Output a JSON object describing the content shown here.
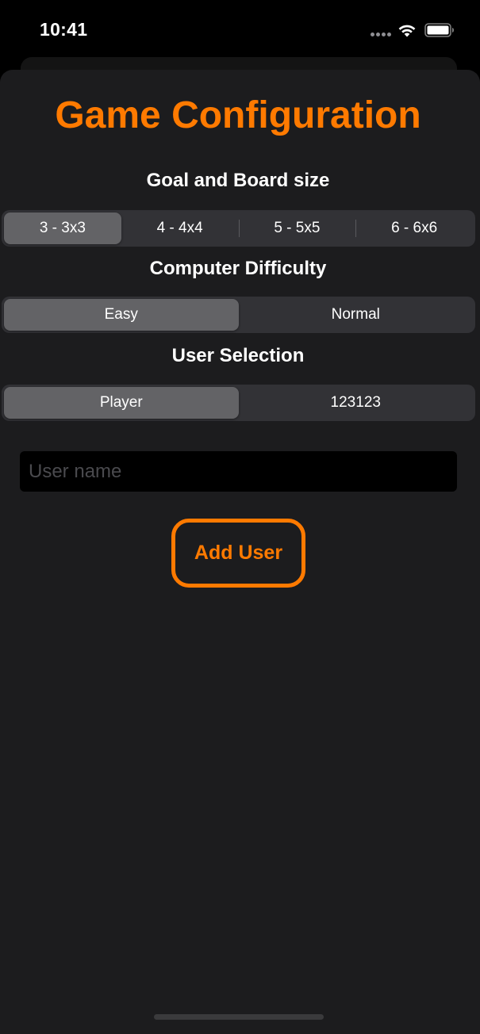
{
  "status_bar": {
    "time": "10:41"
  },
  "screen": {
    "title": "Game Configuration",
    "accent_color": "#ff7a00"
  },
  "board_size": {
    "label": "Goal and Board size",
    "options": [
      "3 - 3x3",
      "4 - 4x4",
      "5 - 5x5",
      "6 - 6x6"
    ],
    "selected": "3 - 3x3"
  },
  "difficulty": {
    "label": "Computer Difficulty",
    "options": [
      "Easy",
      "Normal"
    ],
    "selected": "Easy"
  },
  "user_selection": {
    "label": "User Selection",
    "options": [
      "Player",
      "123123"
    ],
    "selected": "Player"
  },
  "user_name_field": {
    "placeholder": "User name",
    "value": ""
  },
  "add_user_button": {
    "label": "Add User"
  },
  "icons": [
    "wifi-icon",
    "battery-icon",
    "signal-dots-icon"
  ]
}
